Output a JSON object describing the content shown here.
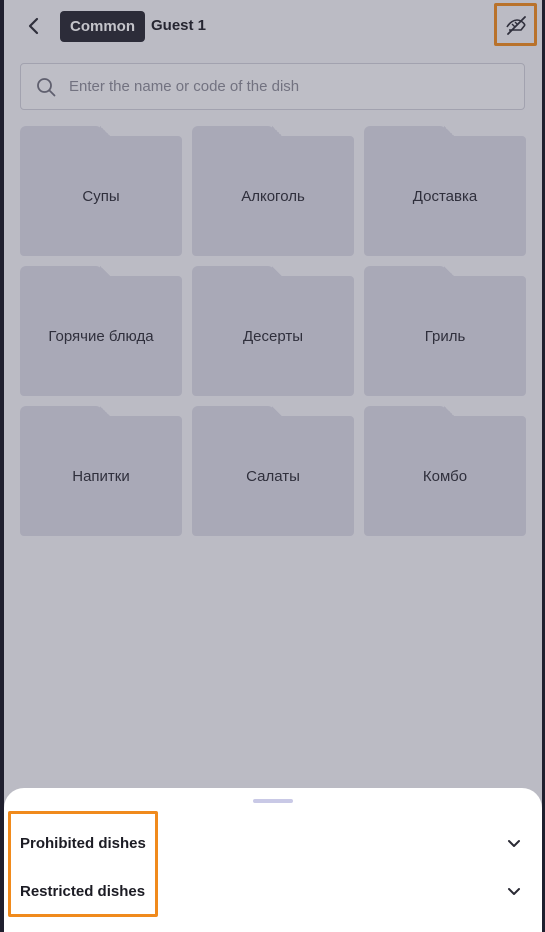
{
  "header": {
    "back_icon": "chevron-left-icon",
    "chip_label": "Common",
    "guest_label": "Guest 1",
    "right_icon": "visibility-off-icon",
    "highlight_color": "#f08a1c"
  },
  "search": {
    "placeholder": "Enter the name or code of the dish",
    "value": "",
    "icon": "search-icon"
  },
  "categories": [
    {
      "label": "Супы"
    },
    {
      "label": "Алкоголь"
    },
    {
      "label": "Доставка"
    },
    {
      "label": "Горячие блюда"
    },
    {
      "label": "Десерты"
    },
    {
      "label": "Гриль"
    },
    {
      "label": "Напитки"
    },
    {
      "label": "Салаты"
    },
    {
      "label": "Комбо"
    }
  ],
  "sheet": {
    "rows": [
      {
        "label": "Prohibited dishes",
        "icon": "chevron-down-icon"
      },
      {
        "label": "Restricted dishes",
        "icon": "chevron-down-icon"
      }
    ]
  },
  "colors": {
    "accent": "#f08a1c",
    "chip_bg": "#262630",
    "folder": "#d9d9e4"
  }
}
